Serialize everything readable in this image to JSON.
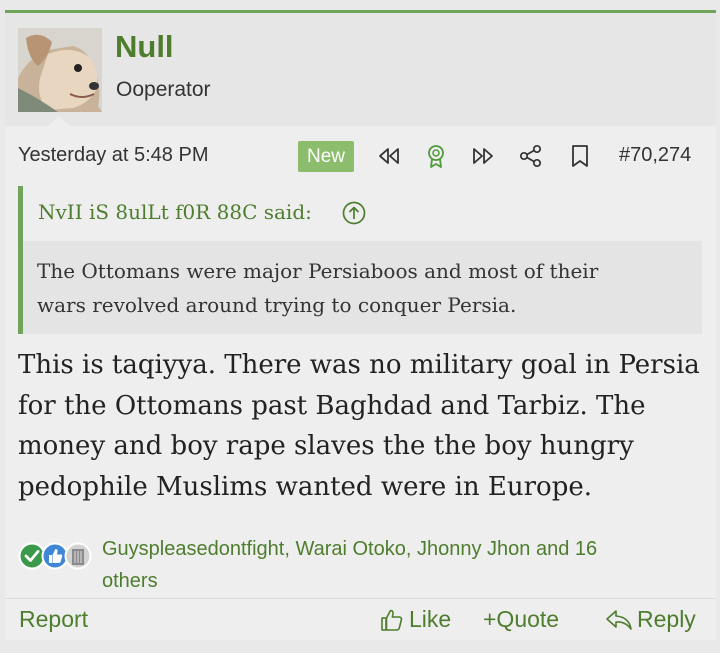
{
  "post": {
    "author": {
      "name": "Null",
      "title": "Ooperator",
      "avatar": "dog-avatar"
    },
    "date": "Yesterday at 5:48 PM",
    "badge": "New",
    "number": "#70,274",
    "meta_icons": [
      "rewind-icon",
      "award-icon",
      "fast-forward-icon",
      "share-icon",
      "bookmark-icon"
    ]
  },
  "quote": {
    "author": "NvII iS 8ulLt f0R 88C said:",
    "lines": [
      "The Ottomans were major Persiaboos and most of their",
      "wars revolved around trying to conquer Persia."
    ]
  },
  "message": {
    "lines": [
      "This is taqiyya. There was no military goal in Persia",
      "for the Ottomans past Baghdad and Tarbiz. The",
      "money and boy rape slaves the the boy hungry",
      "pedophile Muslims wanted were in Europe."
    ]
  },
  "reactions": {
    "icons": [
      "agree-icon",
      "like-icon",
      "trash-icon"
    ],
    "users_line1": "Guyspleasedontfight, Warai Otoko, Jhonny Jhon and 16",
    "users_line2": "others"
  },
  "actions": {
    "report": "Report",
    "like": "Like",
    "quote": "+Quote",
    "reply": "Reply"
  },
  "colors": {
    "accent": "#4e7d2e",
    "badge": "#8bbd6c",
    "border": "#6fa45a"
  }
}
